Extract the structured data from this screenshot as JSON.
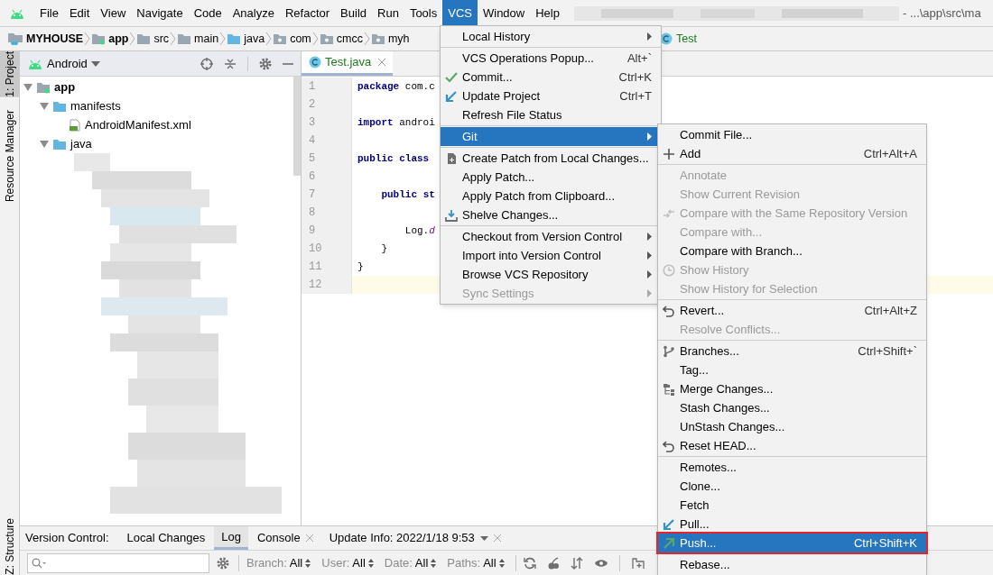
{
  "menu_bar": {
    "items": [
      {
        "label": "File",
        "selected": false
      },
      {
        "label": "Edit",
        "selected": false
      },
      {
        "label": "View",
        "selected": false
      },
      {
        "label": "Navigate",
        "selected": false
      },
      {
        "label": "Code",
        "selected": false
      },
      {
        "label": "Analyze",
        "selected": false
      },
      {
        "label": "Refactor",
        "selected": false
      },
      {
        "label": "Build",
        "selected": false
      },
      {
        "label": "Run",
        "selected": false
      },
      {
        "label": "Tools",
        "selected": false
      },
      {
        "label": "VCS",
        "selected": true
      },
      {
        "label": "Window",
        "selected": false
      },
      {
        "label": "Help",
        "selected": false
      }
    ],
    "title": "- ...\\app\\src\\ma"
  },
  "breadcrumbs": [
    {
      "label": "MYHOUSE",
      "kind": "project"
    },
    {
      "label": "app",
      "kind": "module"
    },
    {
      "label": "src",
      "kind": "folder"
    },
    {
      "label": "main",
      "kind": "folder"
    },
    {
      "label": "java",
      "kind": "source"
    },
    {
      "label": "com",
      "kind": "package"
    },
    {
      "label": "cmcc",
      "kind": "package"
    },
    {
      "label": "myh",
      "kind": "package"
    }
  ],
  "breadcrumb_tail": {
    "label": "Test"
  },
  "left_stripe": {
    "top": [
      {
        "label": "1: Project",
        "selected": true
      },
      {
        "label": "Resource Manager",
        "selected": false
      }
    ],
    "bottom": [
      {
        "label": "Z: Structure",
        "selected": false
      }
    ]
  },
  "project_panel": {
    "view": "Android",
    "tree": [
      {
        "label": "app",
        "kind": "module",
        "expanded": true,
        "children": [
          {
            "label": "manifests",
            "kind": "folder",
            "expanded": true,
            "children": [
              {
                "label": "AndroidManifest.xml",
                "kind": "manifest"
              }
            ]
          },
          {
            "label": "java",
            "kind": "folder",
            "expanded": true
          }
        ]
      }
    ]
  },
  "editor": {
    "tab": {
      "label": "Test.java"
    },
    "lines": [
      {
        "number": "1",
        "code": "**package** com.c",
        "current": false
      },
      {
        "number": "2",
        "current": false
      },
      {
        "number": "3",
        "code": "**import** androi",
        "current": false
      },
      {
        "number": "4",
        "current": false
      },
      {
        "number": "5",
        "code": "**public class** ",
        "current": false
      },
      {
        "number": "6",
        "current": false
      },
      {
        "number": "7",
        "code": "    **public** **st**",
        "current": false
      },
      {
        "number": "8",
        "current": false
      },
      {
        "number": "9",
        "code": "        Log.*d*",
        "current": false
      },
      {
        "number": "10",
        "code": "    }",
        "current": false
      },
      {
        "number": "11",
        "code": "}",
        "current": false
      },
      {
        "number": "12",
        "current": true
      }
    ]
  },
  "vcs_menu": {
    "items": [
      {
        "kind": "item",
        "label": "Local History",
        "submenu": true,
        "disabled": false,
        "selected": false
      },
      {
        "kind": "separator"
      },
      {
        "kind": "item",
        "label": "VCS Operations Popup...",
        "shortcut": "Alt+`",
        "disabled": false,
        "selected": false
      },
      {
        "kind": "item",
        "label": "Commit...",
        "shortcut": "Ctrl+K",
        "disabled": false,
        "selected": false
      },
      {
        "kind": "item",
        "label": "Update Project",
        "shortcut": "Ctrl+T",
        "disabled": false,
        "selected": false
      },
      {
        "kind": "item",
        "label": "Refresh File Status",
        "disabled": false,
        "selected": false
      },
      {
        "kind": "separator"
      },
      {
        "kind": "item",
        "label": "Git",
        "submenu": true,
        "disabled": false,
        "selected": true
      },
      {
        "kind": "separator"
      },
      {
        "kind": "item",
        "label": "Create Patch from Local Changes...",
        "disabled": false,
        "selected": false
      },
      {
        "kind": "item",
        "label": "Apply Patch...",
        "disabled": false,
        "selected": false
      },
      {
        "kind": "item",
        "label": "Apply Patch from Clipboard...",
        "disabled": false,
        "selected": false
      },
      {
        "kind": "item",
        "label": "Shelve Changes...",
        "disabled": false,
        "selected": false
      },
      {
        "kind": "separator"
      },
      {
        "kind": "item",
        "label": "Checkout from Version Control",
        "submenu": true,
        "disabled": false,
        "selected": false
      },
      {
        "kind": "item",
        "label": "Import into Version Control",
        "submenu": true,
        "disabled": false,
        "selected": false
      },
      {
        "kind": "item",
        "label": "Browse VCS Repository",
        "submenu": true,
        "disabled": false,
        "selected": false
      },
      {
        "kind": "item",
        "label": "Sync Settings",
        "submenu": true,
        "disabled": true,
        "selected": false
      }
    ]
  },
  "git_menu": {
    "selection_outline": true,
    "items": [
      {
        "kind": "item",
        "label": "Commit File...",
        "disabled": false,
        "selected": false
      },
      {
        "kind": "item",
        "label": "Add",
        "shortcut": "Ctrl+Alt+A",
        "disabled": false,
        "selected": false
      },
      {
        "kind": "separator"
      },
      {
        "kind": "item",
        "label": "Annotate",
        "disabled": true,
        "selected": false
      },
      {
        "kind": "item",
        "label": "Show Current Revision",
        "disabled": true,
        "selected": false
      },
      {
        "kind": "item",
        "label": "Compare with the Same Repository Version",
        "disabled": true,
        "selected": false
      },
      {
        "kind": "item",
        "label": "Compare with...",
        "disabled": true,
        "selected": false
      },
      {
        "kind": "item",
        "label": "Compare with Branch...",
        "disabled": false,
        "selected": false
      },
      {
        "kind": "item",
        "label": "Show History",
        "disabled": true,
        "selected": false
      },
      {
        "kind": "item",
        "label": "Show History for Selection",
        "disabled": true,
        "selected": false
      },
      {
        "kind": "separator"
      },
      {
        "kind": "item",
        "label": "Revert...",
        "shortcut": "Ctrl+Alt+Z",
        "disabled": false,
        "selected": false
      },
      {
        "kind": "item",
        "label": "Resolve Conflicts...",
        "disabled": true,
        "selected": false
      },
      {
        "kind": "separator"
      },
      {
        "kind": "item",
        "label": "Branches...",
        "shortcut": "Ctrl+Shift+`",
        "disabled": false,
        "selected": false
      },
      {
        "kind": "item",
        "label": "Tag...",
        "disabled": false,
        "selected": false
      },
      {
        "kind": "item",
        "label": "Merge Changes...",
        "disabled": false,
        "selected": false
      },
      {
        "kind": "item",
        "label": "Stash Changes...",
        "disabled": false,
        "selected": false
      },
      {
        "kind": "item",
        "label": "UnStash Changes...",
        "disabled": false,
        "selected": false
      },
      {
        "kind": "item",
        "label": "Reset HEAD...",
        "disabled": false,
        "selected": false
      },
      {
        "kind": "separator"
      },
      {
        "kind": "item",
        "label": "Remotes...",
        "disabled": false,
        "selected": false
      },
      {
        "kind": "item",
        "label": "Clone...",
        "disabled": false,
        "selected": false
      },
      {
        "kind": "item",
        "label": "Fetch",
        "disabled": false,
        "selected": false
      },
      {
        "kind": "item",
        "label": "Pull...",
        "disabled": false,
        "selected": false
      },
      {
        "kind": "item",
        "label": "Push...",
        "shortcut": "Ctrl+Shift+K",
        "disabled": false,
        "selected": true
      },
      {
        "kind": "separator"
      },
      {
        "kind": "item",
        "label": "Rebase...",
        "disabled": false,
        "selected": false
      }
    ]
  },
  "bottom_panel": {
    "title": "Version Control:",
    "tabs": [
      {
        "label": "Local Changes",
        "selected": false,
        "closable": false,
        "dropdown": false
      },
      {
        "label": "Log",
        "selected": true,
        "closable": false,
        "dropdown": false
      },
      {
        "label": "Console",
        "selected": false,
        "closable": true,
        "dropdown": false
      },
      {
        "label": "Update Info: 2022/1/18 9:53",
        "selected": false,
        "closable": true,
        "dropdown": true
      }
    ],
    "filters": [
      {
        "label": "Branch:",
        "value": "All"
      },
      {
        "label": "User:",
        "value": "All"
      },
      {
        "label": "Date:",
        "value": "All"
      },
      {
        "label": "Paths:",
        "value": "All"
      }
    ]
  }
}
